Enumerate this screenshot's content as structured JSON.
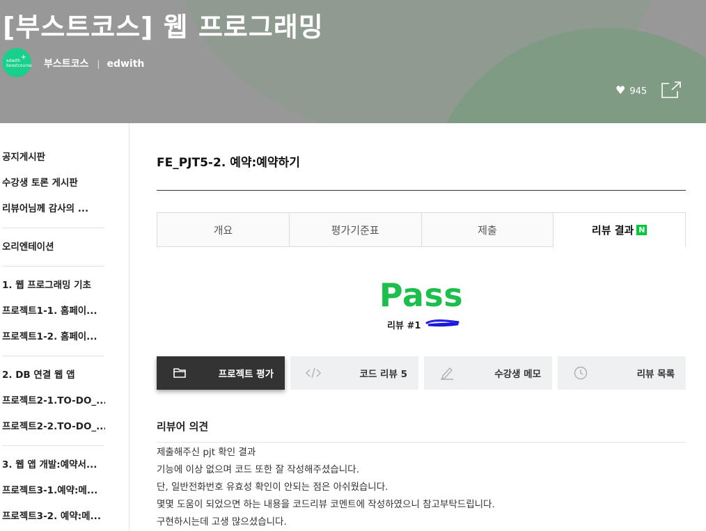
{
  "header": {
    "course_title": "[부스트코스] 웹 프로그래밍",
    "logo_text_line1": "edwith",
    "logo_text_line2": "boostcourse",
    "breadcrumb_primary": "부스트코스",
    "breadcrumb_separator": "|",
    "breadcrumb_secondary": "edwith",
    "like_count": "945",
    "icons": [
      "heart-icon",
      "share-icon"
    ]
  },
  "sidebar": {
    "groups": [
      [
        "공지게시판",
        "수강생 토론 게시판",
        "리뷰어님께 감사의 ..."
      ],
      [
        "오리엔테이션"
      ],
      [
        "1. 웹 프로그래밍 기초",
        "프로젝트1-1. 홈페이...",
        "프로젝트1-2. 홈페이..."
      ],
      [
        "2. DB 연결 웹 앱",
        "프로젝트2-1.TO-DO_...",
        "프로젝트2-2.TO-DO_..."
      ],
      [
        "3. 웹 앱 개발:예약서...",
        "프로젝트3-1.예약:메...",
        "프로젝트3-2. 예약:메..."
      ]
    ]
  },
  "main": {
    "mission_title": "FE_PJT5-2. 예약:예약하기",
    "tabs": [
      {
        "label": "개요",
        "active": false
      },
      {
        "label": "평가기준표",
        "active": false
      },
      {
        "label": "제출",
        "active": false
      },
      {
        "label": "리뷰 결과",
        "active": true,
        "badge": "N"
      }
    ],
    "result": "Pass",
    "review_number": "리뷰 #1",
    "actions": [
      {
        "label": "프로젝트 평가",
        "icon": "folder-icon",
        "active": true
      },
      {
        "label": "코드 리뷰 5",
        "icon": "code-icon",
        "active": false
      },
      {
        "label": "수강생 메모",
        "icon": "pencil-icon",
        "active": false
      },
      {
        "label": "리뷰 목록",
        "icon": "clock-icon",
        "active": false
      }
    ],
    "opinion_title": "리뷰어 의견",
    "opinion_lines": [
      "제출해주신 pjt 확인 결과",
      "기능에 이상 없으며 코드 또한 잘 작성해주셨습니다.",
      "단, 일반전화번호 유효성 확인이 안되는 점은 아쉬웠습니다.",
      "몇몇 도움이 되었으면 하는 내용을 코드리뷰 코멘트에 작성하였으니 참고부탁드립니다.",
      "구현하시는데 고생 많으셨습니다."
    ]
  },
  "colors": {
    "pass_green": "#1cbf4b",
    "badge_green": "#00c73c",
    "logo_green": "#19cf8c",
    "primary_button": "#333333"
  }
}
